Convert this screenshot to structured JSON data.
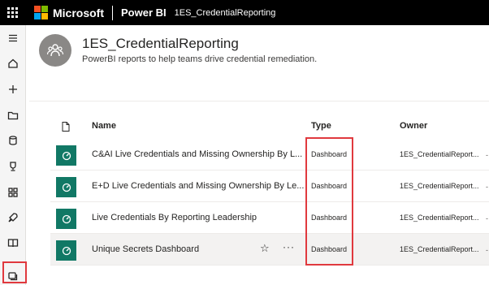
{
  "topbar": {
    "brand": "Microsoft",
    "product": "Power BI",
    "breadcrumb": "1ES_CredentialReporting",
    "logo_colors": [
      "#f25022",
      "#7fba00",
      "#00a4ef",
      "#ffb900"
    ]
  },
  "rail": {
    "items": [
      {
        "icon": "hamburger-icon"
      },
      {
        "icon": "home-icon"
      },
      {
        "icon": "plus-icon"
      },
      {
        "icon": "folder-icon"
      },
      {
        "icon": "database-icon"
      },
      {
        "icon": "trophy-icon"
      },
      {
        "icon": "apps-icon"
      },
      {
        "icon": "rocket-icon"
      },
      {
        "icon": "book-icon"
      },
      {
        "icon": "workspaces-icon"
      }
    ]
  },
  "workspace": {
    "title": "1ES_CredentialReporting",
    "description": "PowerBI reports to help teams drive credential remediation."
  },
  "table": {
    "columns": {
      "name": "Name",
      "type": "Type",
      "owner": "Owner"
    },
    "rows": [
      {
        "name": "C&AI Live Credentials and Missing Ownership By L...",
        "type": "Dashboard",
        "owner": "1ES_CredentialReport...",
        "trail": "-"
      },
      {
        "name": "E+D Live Credentials and Missing Ownership By Le...",
        "type": "Dashboard",
        "owner": "1ES_CredentialReport...",
        "trail": "-"
      },
      {
        "name": "Live Credentials By Reporting Leadership",
        "type": "Dashboard",
        "owner": "1ES_CredentialReport...",
        "trail": "-"
      },
      {
        "name": "Unique Secrets Dashboard",
        "type": "Dashboard",
        "owner": "1ES_CredentialReport...",
        "trail": "-",
        "star": "☆",
        "more": "···"
      }
    ]
  },
  "colors": {
    "accent": "#117865",
    "highlight": "#e0393e"
  }
}
